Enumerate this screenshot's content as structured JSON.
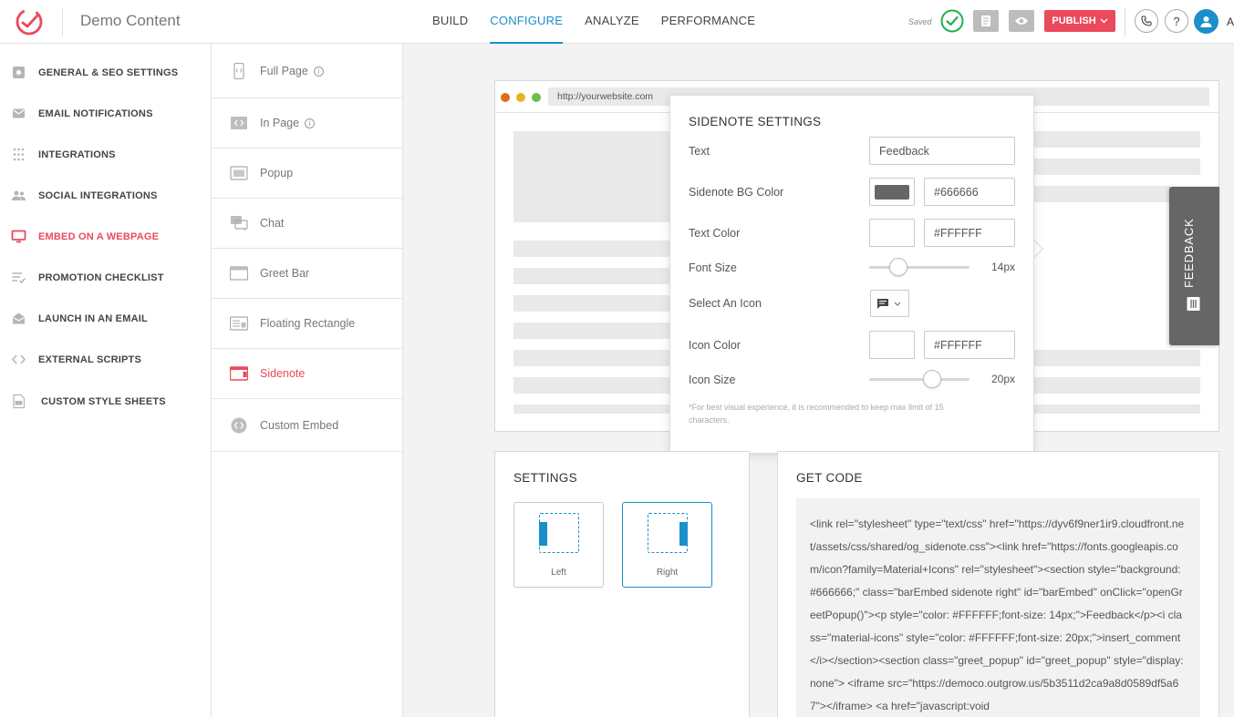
{
  "header": {
    "title": "Demo Content",
    "nav": [
      "BUILD",
      "CONFIGURE",
      "ANALYZE",
      "PERFORMANCE"
    ],
    "active_nav": "CONFIGURE",
    "saved_label": "Saved",
    "publish_label": "PUBLISH",
    "help_label": "?",
    "user_initial": "A"
  },
  "sidebar": {
    "items": [
      {
        "label": "GENERAL & SEO SETTINGS",
        "icon": "gear-icon"
      },
      {
        "label": "EMAIL NOTIFICATIONS",
        "icon": "envelope-icon"
      },
      {
        "label": "INTEGRATIONS",
        "icon": "grid-dots-icon"
      },
      {
        "label": "SOCIAL INTEGRATIONS",
        "icon": "people-icon"
      },
      {
        "label": "EMBED ON A WEBPAGE",
        "icon": "monitor-icon"
      },
      {
        "label": "PROMOTION CHECKLIST",
        "icon": "checklist-icon"
      },
      {
        "label": "LAUNCH IN AN EMAIL",
        "icon": "open-envelope-icon"
      },
      {
        "label": "EXTERNAL SCRIPTS",
        "icon": "code-brackets-icon"
      },
      {
        "label": "CUSTOM STYLE SHEETS",
        "icon": "css-file-icon"
      }
    ],
    "active": "EMBED ON A WEBPAGE",
    "accent_color": "#ea4a5c"
  },
  "embed_types": {
    "items": [
      {
        "label": "Full Page",
        "icon": "mobile-page-icon"
      },
      {
        "label": "In Page",
        "icon": "code-window-icon"
      },
      {
        "label": "Popup",
        "icon": "popup-window-icon"
      },
      {
        "label": "Chat",
        "icon": "chat-bubbles-icon"
      },
      {
        "label": "Greet Bar",
        "icon": "greet-bar-icon"
      },
      {
        "label": "Floating Rectangle",
        "icon": "floating-rectangle-icon"
      },
      {
        "label": "Sidenote",
        "icon": "sidenote-icon"
      },
      {
        "label": "Custom Embed",
        "icon": "custom-embed-icon"
      }
    ],
    "active": "Sidenote"
  },
  "preview": {
    "url": "http://yourwebsite.com",
    "dot_colors": [
      "#e06c1f",
      "#e8b51c",
      "#6cc04a"
    ],
    "sidenote": {
      "text": "FEEDBACK",
      "bg_color": "#666666",
      "icon": "comment-icon"
    }
  },
  "sidenote_settings": {
    "title": "SIDENOTE SETTINGS",
    "text_label": "Text",
    "text_value": "Feedback",
    "bg_color_label": "Sidenote BG Color",
    "bg_color_value": "#666666",
    "text_color_label": "Text Color",
    "text_color_value": "#FFFFFF",
    "font_size_label": "Font Size",
    "font_size_value": "14px",
    "font_size_fraction": 0.29,
    "icon_label": "Select An Icon",
    "icon_value": "comment-icon",
    "icon_color_label": "Icon Color",
    "icon_color_value": "#FFFFFF",
    "icon_size_label": "Icon Size",
    "icon_size_value": "20px",
    "icon_size_fraction": 0.63,
    "note": "*For best visual experience, it is recommended to keep max limit of 15 characters."
  },
  "settings": {
    "title": "SETTINGS",
    "positions": [
      "Left",
      "Right"
    ],
    "selected": "Right"
  },
  "get_code": {
    "title": "GET CODE",
    "code": "<link rel=\"stylesheet\" type=\"text/css\" href=\"https://dyv6f9ner1ir9.cloudfront.net/assets/css/shared/og_sidenote.css\"><link href=\"https://fonts.googleapis.com/icon?family=Material+Icons\" rel=\"stylesheet\"><section style=\"background: #666666;\" class=\"barEmbed sidenote right\" id=\"barEmbed\" onClick=\"openGreetPopup()\"><p style=\"color: #FFFFFF;font-size: 14px;\">Feedback</p><i class=\"material-icons\" style=\"color: #FFFFFF;font-size: 20px;\">insert_comment</i></section><section class=\"greet_popup\" id=\"greet_popup\" style=\"display:none\"> <iframe src=\"https://democo.outgrow.us/5b3511d2ca9a8d0589df5a67\"></iframe> <a href=\"javascript:void"
  }
}
